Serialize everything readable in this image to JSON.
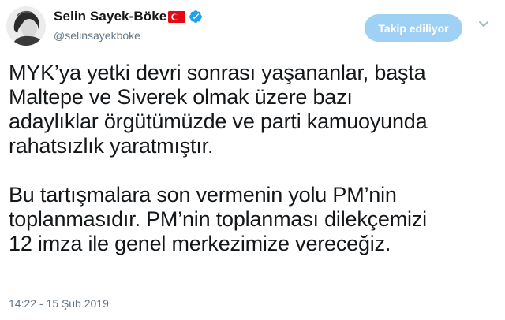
{
  "author": {
    "display_name": "Selin Sayek-Böke",
    "handle": "@selinsayekboke",
    "flag_icon": "turkey-flag-icon",
    "verified_icon": "verified-badge-icon"
  },
  "follow_button": {
    "label": "Takip ediliyor",
    "color": "#9fd1f4"
  },
  "menu": {
    "icon": "chevron-down-icon"
  },
  "tweet": {
    "paragraph1": [
      "MYK’ya yetki devri sonrası yaşananlar, başta",
      "Maltepe ve Siverek olmak üzere bazı",
      "adaylıklar örgütümüzde ve parti kamuoyunda",
      "rahatsızlık yaratmıştır."
    ],
    "paragraph2": [
      "Bu tartışmalara son vermenin yolu PM’nin",
      "toplanmasıdır. PM’nin toplanması dilekçemizi",
      "12 imza ile genel merkezimize vereceğiz."
    ],
    "timestamp": "14:22 - 15 Şub 2019"
  },
  "colors": {
    "text": "#14171a",
    "secondary": "#657786",
    "verified": "#1da1f2",
    "flag_red": "#e30a17"
  }
}
